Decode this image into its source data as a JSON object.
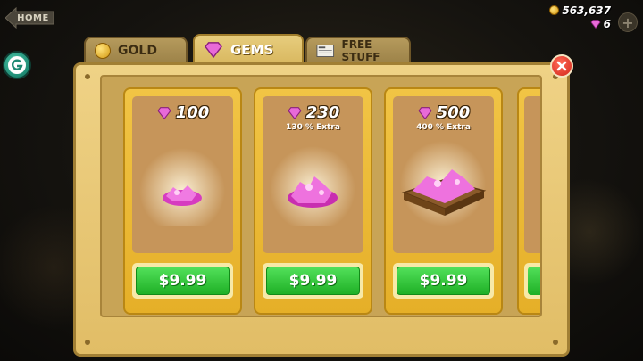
{
  "header": {
    "home_label": "HOME",
    "coins": "563,637",
    "gems": "6",
    "plus_label": "+"
  },
  "tabs": [
    {
      "label": "GOLD",
      "active": false,
      "icon": "coin-icon"
    },
    {
      "label": "GEMS",
      "active": true,
      "icon": "gem-icon"
    },
    {
      "label": "FREE STUFF",
      "active": false,
      "icon": "newspaper-icon"
    }
  ],
  "offers": [
    {
      "amount": "100",
      "extra": "",
      "price": "$9.99",
      "icon": "gem-pile-small"
    },
    {
      "amount": "230",
      "extra": "130 % Extra",
      "price": "$9.99",
      "icon": "gem-pile-medium"
    },
    {
      "amount": "500",
      "extra": "400 % Extra",
      "price": "$9.99",
      "icon": "gem-crate"
    }
  ],
  "colors": {
    "gem": "#e040c8",
    "price_button": "#2ec034",
    "panel": "#e8c570",
    "card": "#efbd38",
    "close": "#e03020"
  }
}
